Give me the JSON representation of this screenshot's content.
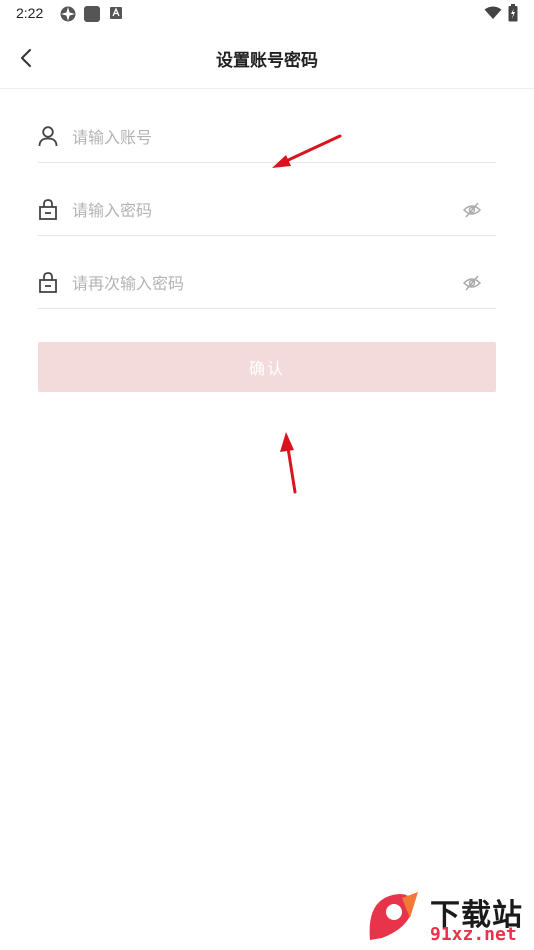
{
  "status_bar": {
    "time": "2:22"
  },
  "header": {
    "title": "设置账号密码",
    "back_icon": "chevron-left-icon"
  },
  "form": {
    "account": {
      "placeholder": "请输入账号",
      "value": "",
      "icon": "user-icon"
    },
    "password": {
      "placeholder": "请输入密码",
      "value": "",
      "icon": "lock-icon",
      "toggle_icon": "eye-off-icon"
    },
    "confirm_password": {
      "placeholder": "请再次输入密码",
      "value": "",
      "icon": "lock-icon",
      "toggle_icon": "eye-off-icon"
    }
  },
  "confirm_button": {
    "label": "确认",
    "color": "#f3dadb"
  },
  "watermark": {
    "brand": "下载站",
    "site": "91xz.net"
  },
  "colors": {
    "accent": "#e8344a",
    "annotation_arrow": "#d9141e"
  }
}
